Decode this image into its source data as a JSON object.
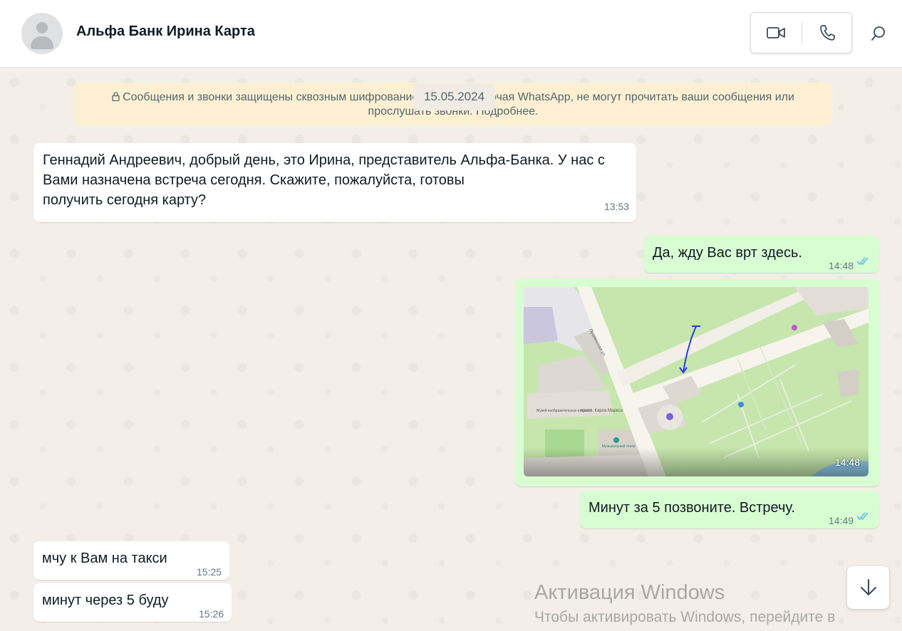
{
  "header": {
    "contact_name": "Альфа Банк Ирина Карта",
    "video_icon": "video-camera-icon",
    "call_icon": "phone-icon",
    "search_icon": "search-icon"
  },
  "chat": {
    "encryption_line1": "Сообщения и звонки защищены сквозным шифрованием. Никто, включая WhatsApp, не могут прочитать ваши сообщения или",
    "encryption_line2": "прослушать звонки. Подробнее.",
    "date_pill": "15.05.2024",
    "messages": [
      {
        "direction": "in",
        "text": "Геннадий Андреевич, добрый день, это Ирина, представитель Альфа-Банка. У нас с\nВами назначена встреча сегодня. Скажите, пожалуйста, готовы\nполучить сегодня карту?",
        "time": "13:53"
      },
      {
        "direction": "out",
        "text": "Да, жду Вас врт здесь.",
        "time": "14:48",
        "status": "read"
      },
      {
        "direction": "out",
        "type": "image",
        "time": "14:48",
        "image_kind": "map-screenshot"
      },
      {
        "direction": "out",
        "text": "Минут за 5 позвоните. Встречу.",
        "time": "14:49",
        "status": "read"
      },
      {
        "direction": "in",
        "text": "мчу к Вам на такси",
        "time": "15:25"
      },
      {
        "direction": "in",
        "text": "минут через 5 буду",
        "time": "15:26"
      }
    ]
  },
  "map_labels": {
    "street_1": "просп. Карла Маркса",
    "street_2": "Пушкинская ул.",
    "theatre": "Музыкальный театр",
    "museum": "Музей изобразительных искусств"
  },
  "watermark": {
    "line1": "Активация Windows",
    "line2": "Чтобы активировать Windows, перейдите в"
  },
  "colors": {
    "outgoing_bubble": "#d9fdd3",
    "incoming_bubble": "#ffffff",
    "read_ticks": "#53bdeb",
    "encryption_banner": "#fdf0d2"
  }
}
